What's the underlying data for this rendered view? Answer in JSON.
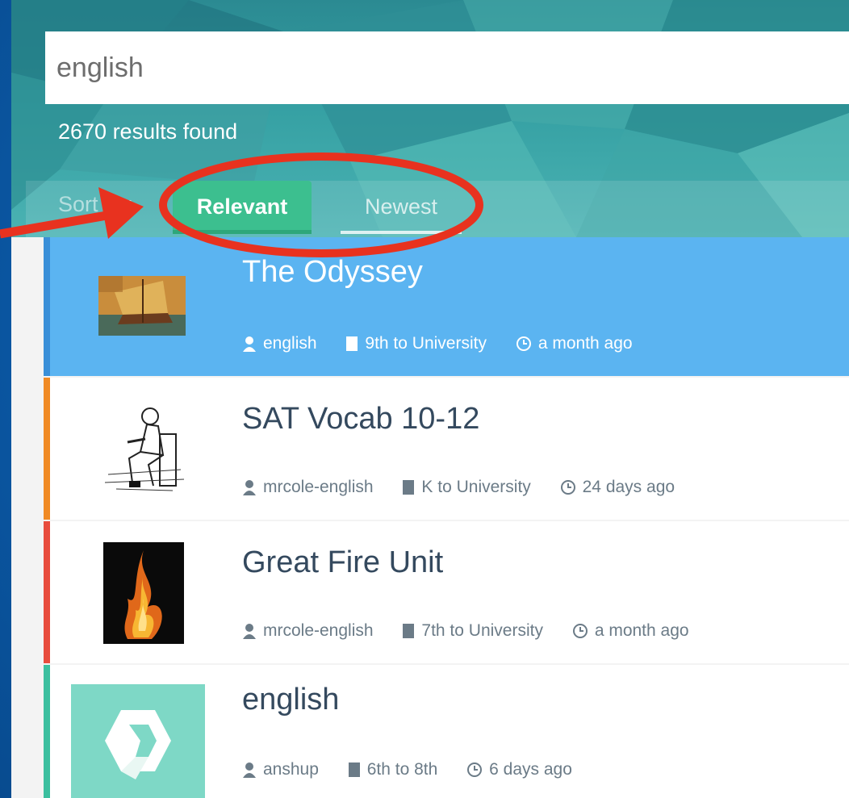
{
  "search": {
    "value": "english"
  },
  "results_text": "2670 results found",
  "sort": {
    "label": "Sort by:",
    "options": [
      "Relevant",
      "Newest"
    ],
    "selected": "Relevant"
  },
  "colors": {
    "accent_green": "#3cbf8f",
    "active_blue": "#5bb4f1",
    "annotation_red": "#e8321f",
    "frame_blue": "#0b5aa8"
  },
  "cards": [
    {
      "title": "The Odyssey",
      "author": "english",
      "grade": "9th to University",
      "time": "a month ago",
      "accent": "#3a8fd8",
      "thumb": "ship-painting"
    },
    {
      "title": "SAT Vocab 10-12",
      "author": "mrcole-english",
      "grade": "K to University",
      "time": "24 days ago",
      "accent": "#f08a24",
      "thumb": "man-reading-sketch"
    },
    {
      "title": "Great Fire Unit",
      "author": "mrcole-english",
      "grade": "7th to University",
      "time": "a month ago",
      "accent": "#e84c3d",
      "thumb": "fire-photo"
    },
    {
      "title": "english",
      "author": "anshup",
      "grade": "6th to 8th",
      "time": "6 days ago",
      "accent": "#3cbf9f",
      "thumb": "app-logo"
    }
  ],
  "annotation": {
    "type": "red-arrow-and-ellipse",
    "target": "sort-options"
  }
}
